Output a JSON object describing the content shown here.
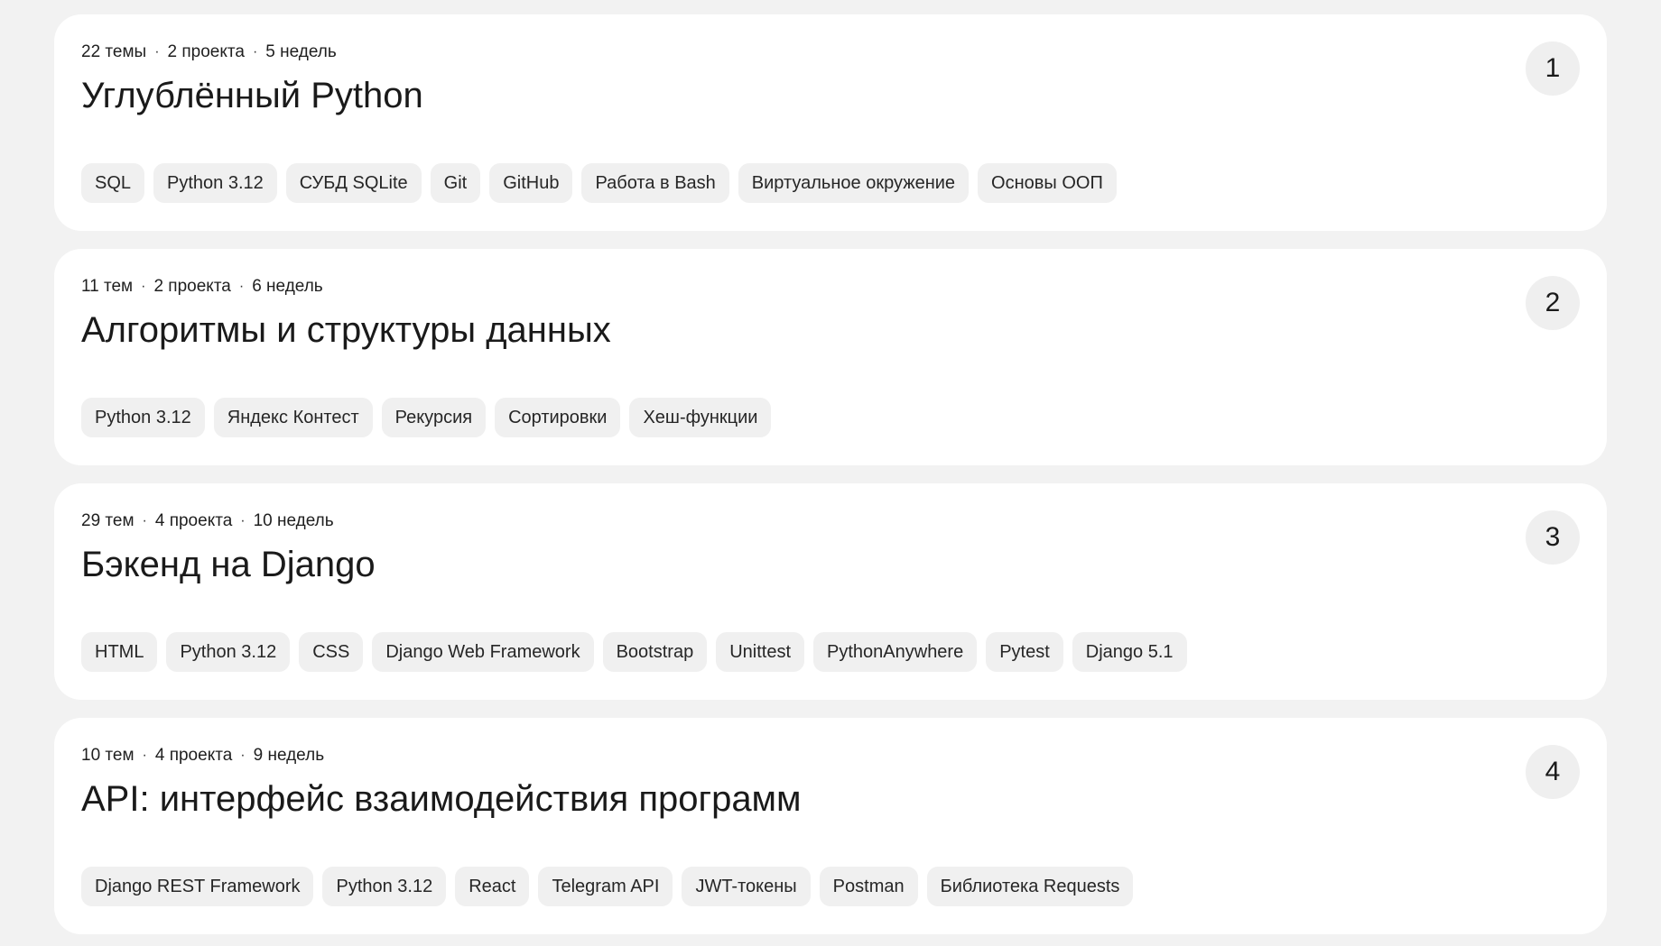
{
  "courses": [
    {
      "number": "1",
      "meta": {
        "topics": "22 темы",
        "projects": "2 проекта",
        "weeks": "5 недель"
      },
      "title": "Углублённый Python",
      "tags": [
        "SQL",
        "Python 3.12",
        "СУБД SQLite",
        "Git",
        "GitHub",
        "Работа в Bash",
        "Виртуальное окружение",
        "Основы ООП"
      ]
    },
    {
      "number": "2",
      "meta": {
        "topics": "11 тем",
        "projects": "2 проекта",
        "weeks": "6 недель"
      },
      "title": "Алгоритмы и структуры данных",
      "tags": [
        "Python 3.12",
        "Яндекс Контест",
        "Рекурсия",
        "Сортировки",
        "Хеш-функции"
      ]
    },
    {
      "number": "3",
      "meta": {
        "topics": "29 тем",
        "projects": "4 проекта",
        "weeks": "10 недель"
      },
      "title": "Бэкенд на Django",
      "tags": [
        "HTML",
        "Python 3.12",
        "CSS",
        "Django Web Framework",
        "Bootstrap",
        "Unittest",
        "PythonAnywhere",
        "Pytest",
        "Django 5.1"
      ]
    },
    {
      "number": "4",
      "meta": {
        "topics": "10 тем",
        "projects": "4 проекта",
        "weeks": "9 недель"
      },
      "title": "API: интерфейс взаимодействия программ",
      "tags": [
        "Django REST Framework",
        "Python 3.12",
        "React",
        "Telegram API",
        "JWT-токены",
        "Postman",
        "Библиотека Requests"
      ]
    }
  ],
  "meta_separator": "·"
}
